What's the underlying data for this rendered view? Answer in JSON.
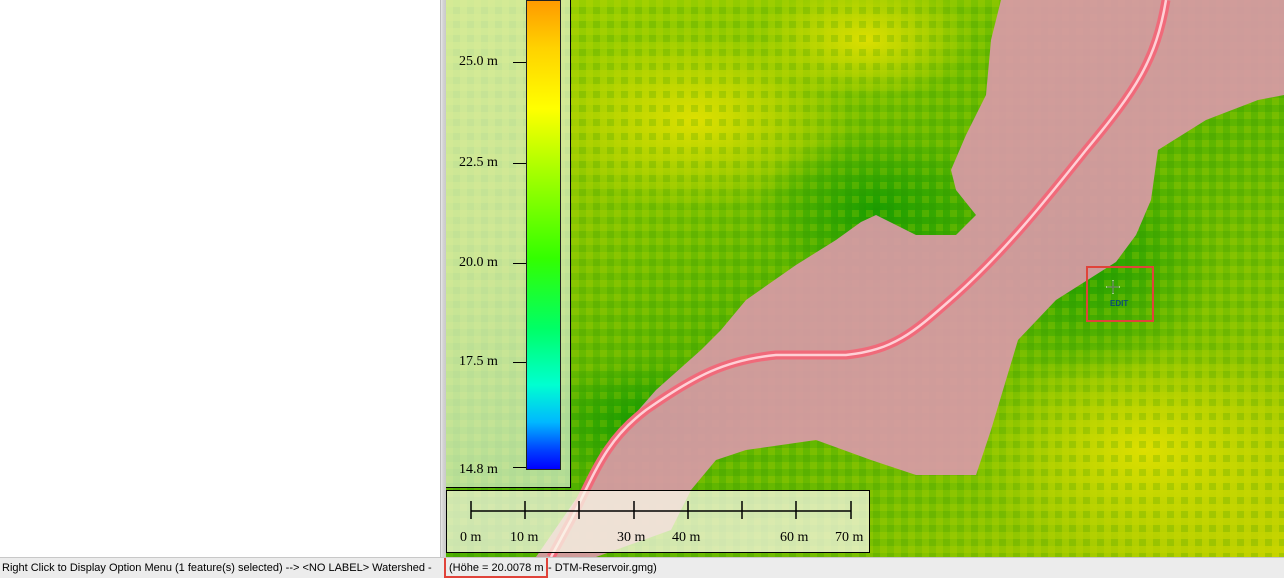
{
  "legend": {
    "ticks": [
      "25.0 m",
      "22.5 m",
      "20.0 m",
      "17.5 m",
      "14.8 m"
    ]
  },
  "scalebar": {
    "labels": [
      "0 m",
      "10 m",
      "30 m",
      "40 m",
      "60 m",
      "70 m"
    ]
  },
  "cursor": {
    "label": "EDIT"
  },
  "status": {
    "text_prefix": "Right Click to Display Option Menu (1 feature(s) selected) --> <NO LABEL> Watershed -",
    "value": "(Höhe = 20.0078 m",
    "file_part": "- DTM-Reservoir.gmg)"
  },
  "colors": {
    "highlight": "#e0433a",
    "watershed": "#d89aa6",
    "stream": "#f06a7a"
  }
}
